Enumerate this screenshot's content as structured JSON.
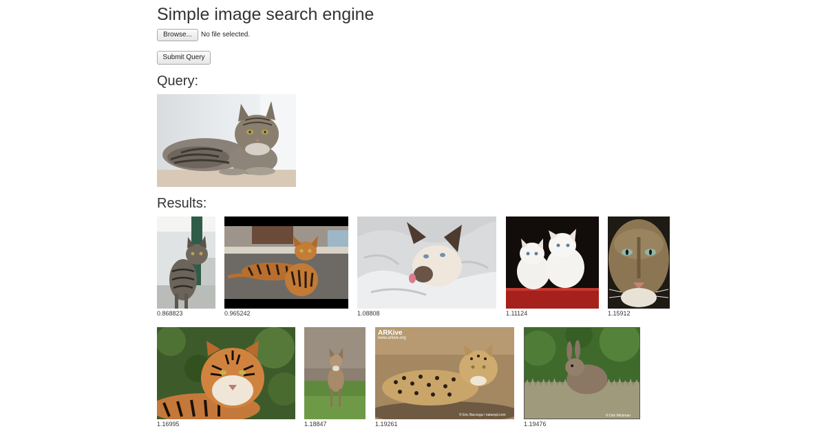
{
  "page": {
    "title": "Simple image search engine"
  },
  "upload": {
    "browse_label": "Browse...",
    "file_status": "No file selected.",
    "submit_label": "Submit Query"
  },
  "query": {
    "heading": "Query:",
    "image_alt": "tabby cat lying down"
  },
  "results": {
    "heading": "Results:",
    "items": [
      {
        "score": "0.868823",
        "subject": "tabby cat standing on porch"
      },
      {
        "score": "0.965242",
        "subject": "bengal cat lying on ground"
      },
      {
        "score": "1.08808",
        "subject": "siamese cat on white blanket"
      },
      {
        "score": "1.11124",
        "subject": "two white persian kittens"
      },
      {
        "score": "1.15912",
        "subject": "cougar face close-up"
      },
      {
        "score": "1.16995",
        "subject": "tiger lying in grass"
      },
      {
        "score": "1.18847",
        "subject": "coyote standing"
      },
      {
        "score": "1.19261",
        "subject": "leopard lying on rock"
      },
      {
        "score": "1.19476",
        "subject": "rabbit in grass"
      }
    ],
    "watermarks": {
      "leopard_logo": "ARKive",
      "leopard_url": "www.arkive.org",
      "leopard_credit": "© Eric Baccega / naturepl.com",
      "rabbit_credit": "© Dirk Wickman"
    }
  }
}
